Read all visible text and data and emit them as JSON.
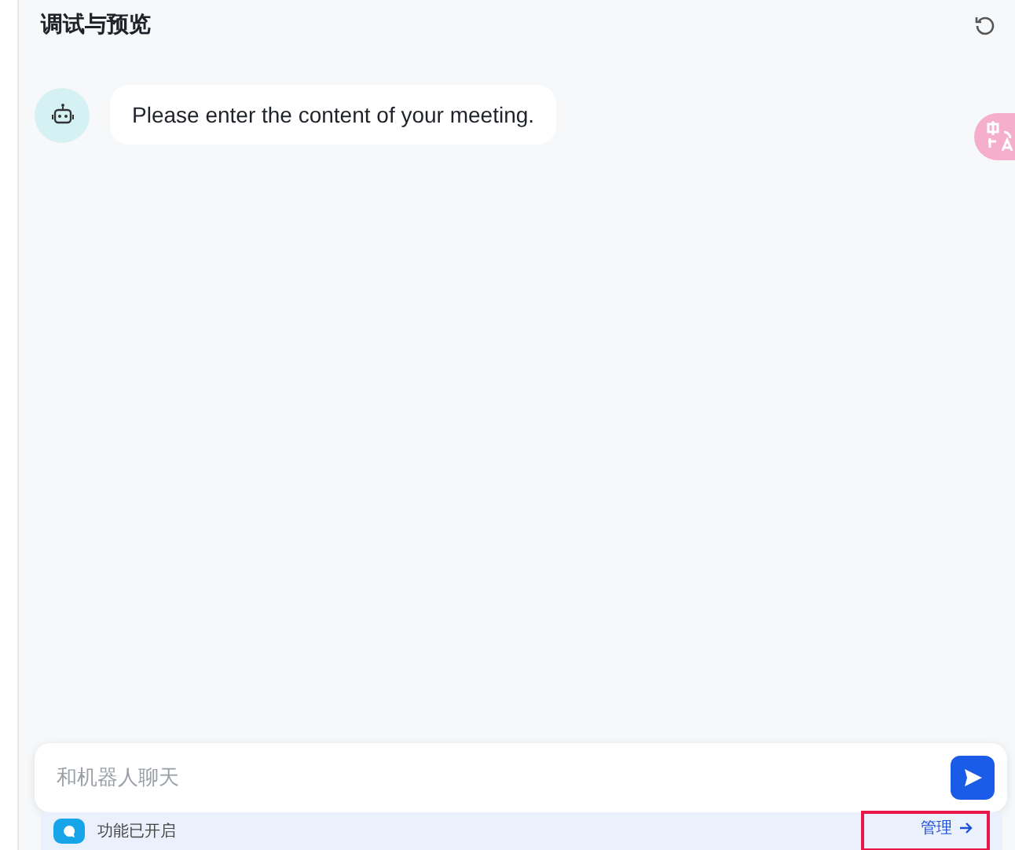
{
  "header": {
    "title": "调试与预览"
  },
  "messages": [
    {
      "kind": "bot",
      "text": "Please enter the content of your meeting."
    }
  ],
  "composer": {
    "placeholder": "和机器人聊天"
  },
  "footer": {
    "status": "功能已开启",
    "link": "管理",
    "highlighted": true
  }
}
